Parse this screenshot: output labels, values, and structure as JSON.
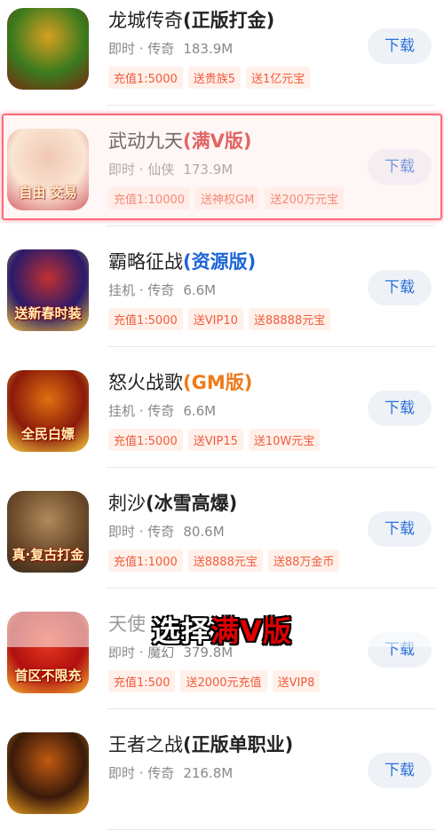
{
  "games": [
    {
      "name": "龙城传奇",
      "suffix": "(正版打金)",
      "suffix_color": "#222222",
      "category": "即时 · 传奇",
      "size": "183.9M",
      "tags": [
        "充值1:5000",
        "送贵族5",
        "送1亿元宝"
      ],
      "download_label": "下载",
      "icon_name": "longcheng-chuanqi-icon",
      "icon_colors": [
        "#3a7a1e",
        "#d8a020",
        "#7a2a10"
      ],
      "icon_text": ""
    },
    {
      "name": "武动九天",
      "suffix": "(满V版)",
      "suffix_color": "#d42020",
      "category": "即时 · 仙侠",
      "size": "173.9M",
      "tags": [
        "充值1:10000",
        "送神权GM",
        "送200万元宝"
      ],
      "download_label": "下载",
      "icon_name": "wudong-jiutian-icon",
      "icon_colors": [
        "#f7e6c8",
        "#e8b89a",
        "#c0202a"
      ],
      "icon_text": "自由 交易"
    },
    {
      "name": "霸略征战",
      "suffix": "(资源版)",
      "suffix_color": "#1e64d8",
      "category": "挂机 · 传奇",
      "size": "6.6M",
      "tags": [
        "充值1:5000",
        "送VIP10",
        "送88888元宝"
      ],
      "download_label": "下载",
      "icon_name": "balue-zhengzhan-icon",
      "icon_colors": [
        "#2a1a6a",
        "#c03030",
        "#f0c040"
      ],
      "icon_text": "送新春时装"
    },
    {
      "name": "怒火战歌",
      "suffix": "(GM版)",
      "suffix_color": "#ef7a1a",
      "category": "挂机 · 传奇",
      "size": "6.6M",
      "tags": [
        "充值1:5000",
        "送VIP15",
        "送10W元宝"
      ],
      "download_label": "下载",
      "icon_name": "nuhuo-zhange-icon",
      "icon_colors": [
        "#8a1a0a",
        "#e07010",
        "#f8d040"
      ],
      "icon_text": "全民白嫖"
    },
    {
      "name": "刺沙",
      "suffix": "(冰雪高爆)",
      "suffix_color": "#222222",
      "category": "即时 · 传奇",
      "size": "80.6M",
      "tags": [
        "充值1:1000",
        "送8888元宝",
        "送88万金币"
      ],
      "download_label": "下载",
      "icon_name": "cisha-icon",
      "icon_colors": [
        "#6a4a2a",
        "#b08a5a",
        "#3a2a1a"
      ],
      "icon_text": "真·复古打金"
    },
    {
      "name": "天使",
      "suffix": "",
      "suffix_color": "#222222",
      "category": "即时 · 魔幻",
      "size": "379.8M",
      "tags": [
        "充值1:500",
        "送2000元充值",
        "送VIP8"
      ],
      "download_label": "下载",
      "icon_name": "tianshi-icon",
      "icon_colors": [
        "#b01010",
        "#e83a20",
        "#f5b030"
      ],
      "icon_text": "首区不限充"
    },
    {
      "name": "王者之战",
      "suffix": "(正版单职业)",
      "suffix_color": "#222222",
      "category": "即时 · 传奇",
      "size": "216.8M",
      "tags": [],
      "download_label": "下载",
      "icon_name": "wangzhe-zhizhan-icon",
      "icon_colors": [
        "#3a1a0a",
        "#c05a10",
        "#f0a020"
      ],
      "icon_text": ""
    }
  ],
  "overlay_caption": {
    "part1": "选择",
    "part2": "满V版"
  },
  "colors": {
    "tag_text": "#f25a3c",
    "tag_bg": "#fff1ea",
    "download_text": "#2b6fd8",
    "download_bg": "#eef2f7",
    "highlight_border": "#ff6a7a"
  }
}
